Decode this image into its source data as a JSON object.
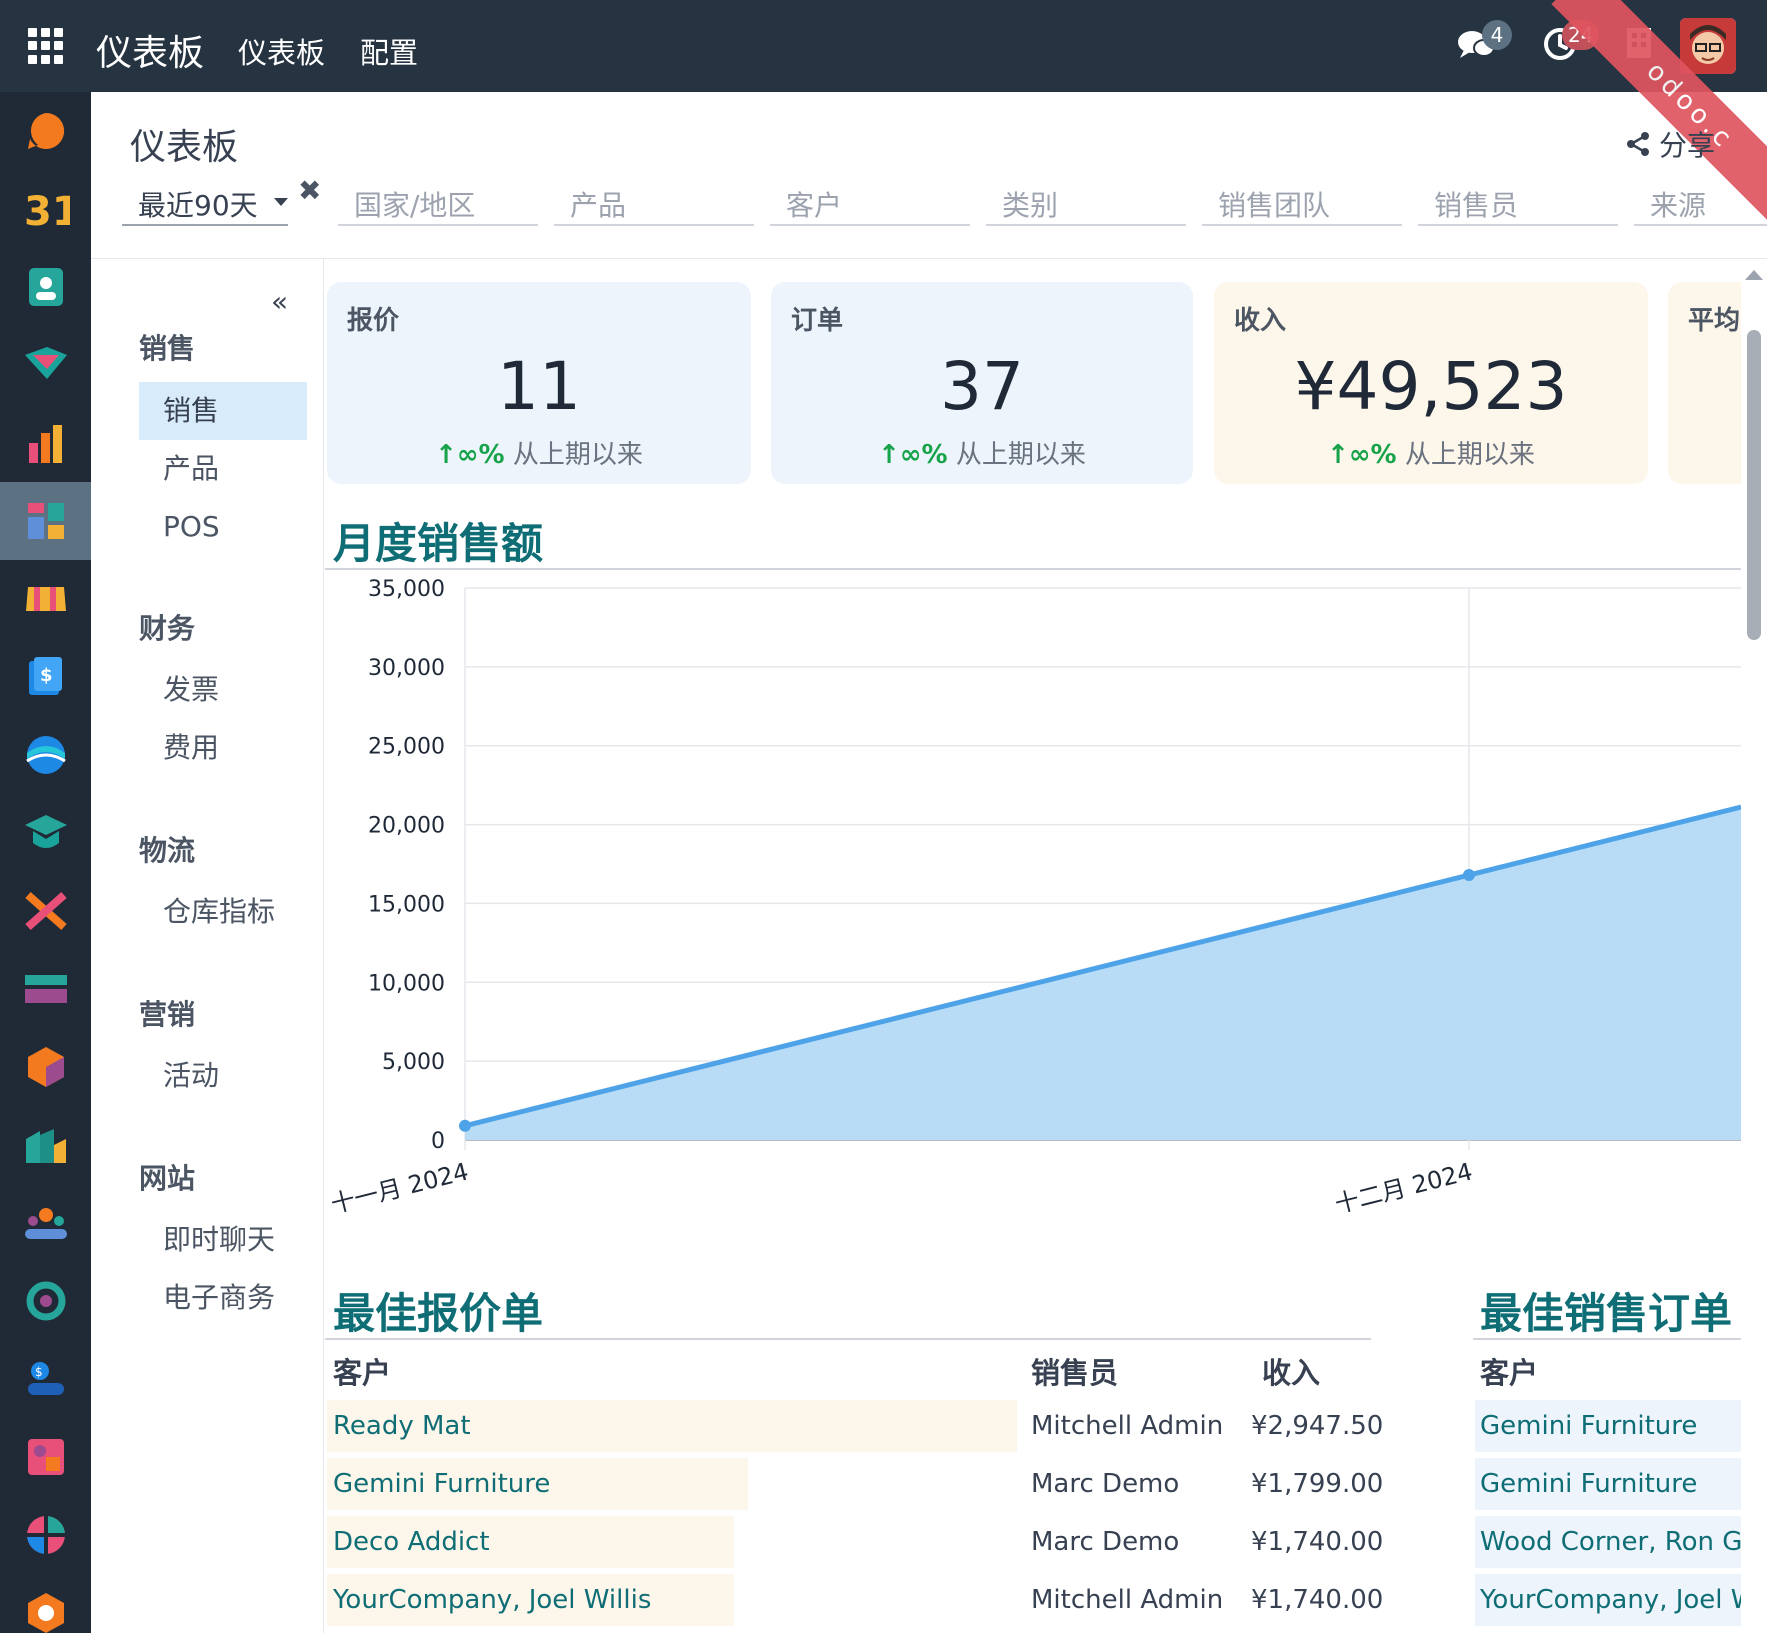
{
  "topbar": {
    "brand": "仪表板",
    "menu": [
      "仪表板",
      "配置"
    ],
    "messages_badge": "4",
    "activities_badge": "24",
    "ribbon": "odoo.c"
  },
  "header": {
    "title": "仪表板",
    "share_label": "分享",
    "filters": [
      {
        "label": "最近90天",
        "active": true
      },
      {
        "label": "国家/地区"
      },
      {
        "label": "产品"
      },
      {
        "label": "客户"
      },
      {
        "label": "类别"
      },
      {
        "label": "销售团队"
      },
      {
        "label": "销售员"
      },
      {
        "label": "来源"
      }
    ]
  },
  "sidenav": {
    "collapse": "«",
    "groups": [
      {
        "label": "销售",
        "items": [
          "销售",
          "产品",
          "POS"
        ]
      },
      {
        "label": "财务",
        "items": [
          "发票",
          "费用"
        ]
      },
      {
        "label": "物流",
        "items": [
          "仓库指标"
        ]
      },
      {
        "label": "营销",
        "items": [
          "活动"
        ]
      },
      {
        "label": "网站",
        "items": [
          "即时聊天",
          "电子商务"
        ]
      }
    ],
    "active_item": "销售"
  },
  "kpis": [
    {
      "title": "报价",
      "value": "11",
      "trend_arrow": "↑",
      "trend_pct": "∞%",
      "trend_text": "从上期以来",
      "color": "#edf4fc"
    },
    {
      "title": "订单",
      "value": "37",
      "trend_arrow": "↑",
      "trend_pct": "∞%",
      "trend_text": "从上期以来",
      "color": "#edf4fc"
    },
    {
      "title": "收入",
      "value": "¥49,523",
      "trend_arrow": "↑",
      "trend_pct": "∞%",
      "trend_text": "从上期以来",
      "color": "#fdf6ea"
    },
    {
      "title": "平均",
      "value": "",
      "trend_arrow": "",
      "trend_pct": "",
      "trend_text": "",
      "color": "#fdf6ea"
    }
  ],
  "monthly_sales": {
    "title": "月度销售额"
  },
  "chart_data": {
    "type": "area",
    "title": "月度销售额",
    "x": [
      "十一月 2024",
      "十二月 2024"
    ],
    "series": [
      {
        "values": [
          900,
          16800
        ],
        "color": "#4ea3e8",
        "fill": "#b8dcf6"
      }
    ],
    "ylim": [
      0,
      35000
    ],
    "yticks": [
      "35,000",
      "30,000",
      "25,000",
      "20,000",
      "15,000",
      "10,000",
      "5,000",
      "0"
    ],
    "grid": true
  },
  "best_quotes": {
    "title": "最佳报价单",
    "columns": [
      "客户",
      "销售员",
      "收入"
    ],
    "rows": [
      {
        "customer": "Ready Mat",
        "salesperson": "Mitchell Admin",
        "revenue": "¥2,947.50",
        "share": 1.0
      },
      {
        "customer": "Gemini Furniture",
        "salesperson": "Marc Demo",
        "revenue": "¥1,799.00",
        "share": 0.61
      },
      {
        "customer": "Deco Addict",
        "salesperson": "Marc Demo",
        "revenue": "¥1,740.00",
        "share": 0.59
      },
      {
        "customer": "YourCompany, Joel Willis",
        "salesperson": "Mitchell Admin",
        "revenue": "¥1,740.00",
        "share": 0.59
      }
    ]
  },
  "best_orders": {
    "title": "最佳销售订单",
    "columns": [
      "客户"
    ],
    "rows": [
      {
        "customer": "Gemini Furniture"
      },
      {
        "customer": "Gemini Furniture"
      },
      {
        "customer": "Wood Corner, Ron Gibson"
      },
      {
        "customer": "YourCompany, Joel Willis"
      }
    ]
  }
}
